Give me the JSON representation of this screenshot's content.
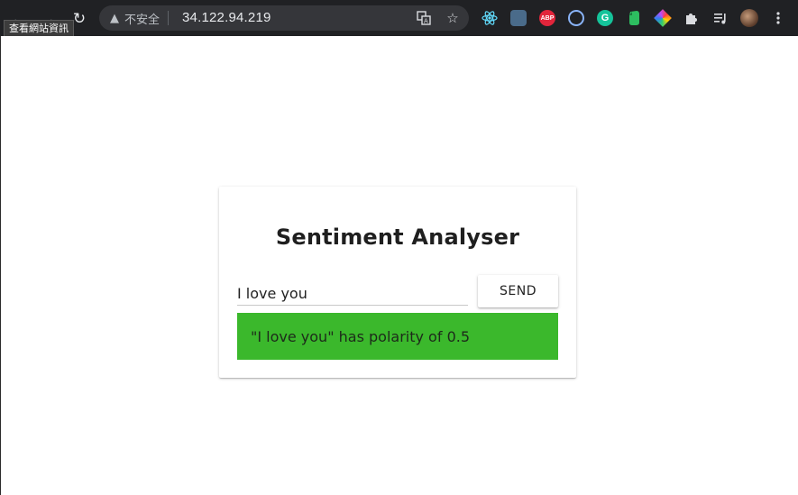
{
  "browser": {
    "tooltip": "查看網站資訊",
    "security_label": "不安全",
    "url": "34.122.94.219",
    "icons": {
      "back": "arrow-left-icon",
      "forward": "arrow-right-icon",
      "reload": "reload-icon",
      "warning": "warning-icon",
      "translate": "translate-icon",
      "bookmark": "star-icon",
      "extensions": [
        "react-icon",
        "extension-icon",
        "abp-icon",
        "circle-icon",
        "grammarly-icon",
        "evernote-icon",
        "colorpicker-icon",
        "puzzle-icon",
        "media-icon",
        "avatar",
        "menu-icon"
      ]
    },
    "abp_badge": "ABP",
    "grammarly_badge": "G"
  },
  "app": {
    "title": "Sentiment Analyser",
    "input_value": "I love you",
    "send_label": "SEND",
    "result_text": "\"I love you\" has polarity of 0.5",
    "colors": {
      "result_background": "#3bb82c",
      "card_background": "#ffffff",
      "toolbar_background": "#202124"
    }
  }
}
